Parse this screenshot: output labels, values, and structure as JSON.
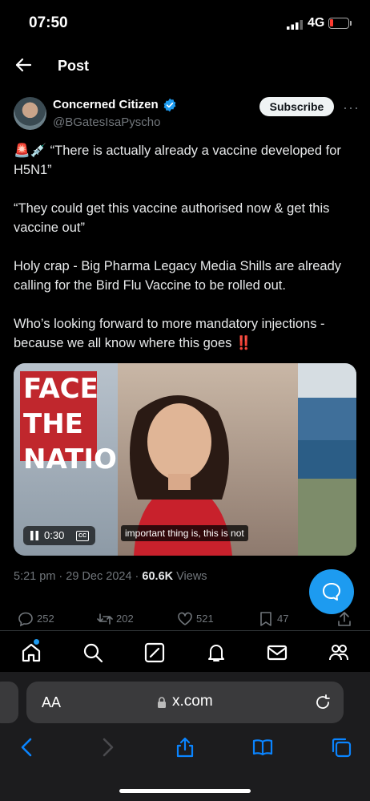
{
  "status": {
    "time": "07:50",
    "network": "4G"
  },
  "header": {
    "title": "Post"
  },
  "author": {
    "name": "Concerned Citizen",
    "handle": "@BGatesIsaPyscho",
    "subscribe_label": "Subscribe"
  },
  "tweet": {
    "emoji_prefix": "🚨💉",
    "line1": " “There is actually already a vaccine developed for H5N1”",
    "para2": "“They could get this vaccine authorised now & get this vaccine out”",
    "para3": "Holy crap - Big Pharma Legacy Media Shills are already calling for the Bird Flu Vaccine to be rolled out.",
    "para4": "Who’s looking forward to more mandatory injections - because we all know where this goes ",
    "para4_emoji": "‼️"
  },
  "video": {
    "logo_text": "FACE THE NATION",
    "elapsed": "0:30",
    "cc_label": "CC",
    "caption": "important thing is, this is not"
  },
  "meta": {
    "date": "5:21 pm · 29 Dec 2024 · ",
    "views_count": "60.6K",
    "views_label": " Views"
  },
  "actions": {
    "replies": "252",
    "reposts": "202",
    "likes": "521",
    "bookmarks": "47"
  },
  "browser": {
    "aa_label": "AA",
    "url": "x.com"
  },
  "colors": {
    "accent": "#1d9bf0",
    "verified": "#1d9bf0",
    "background": "#000000"
  }
}
